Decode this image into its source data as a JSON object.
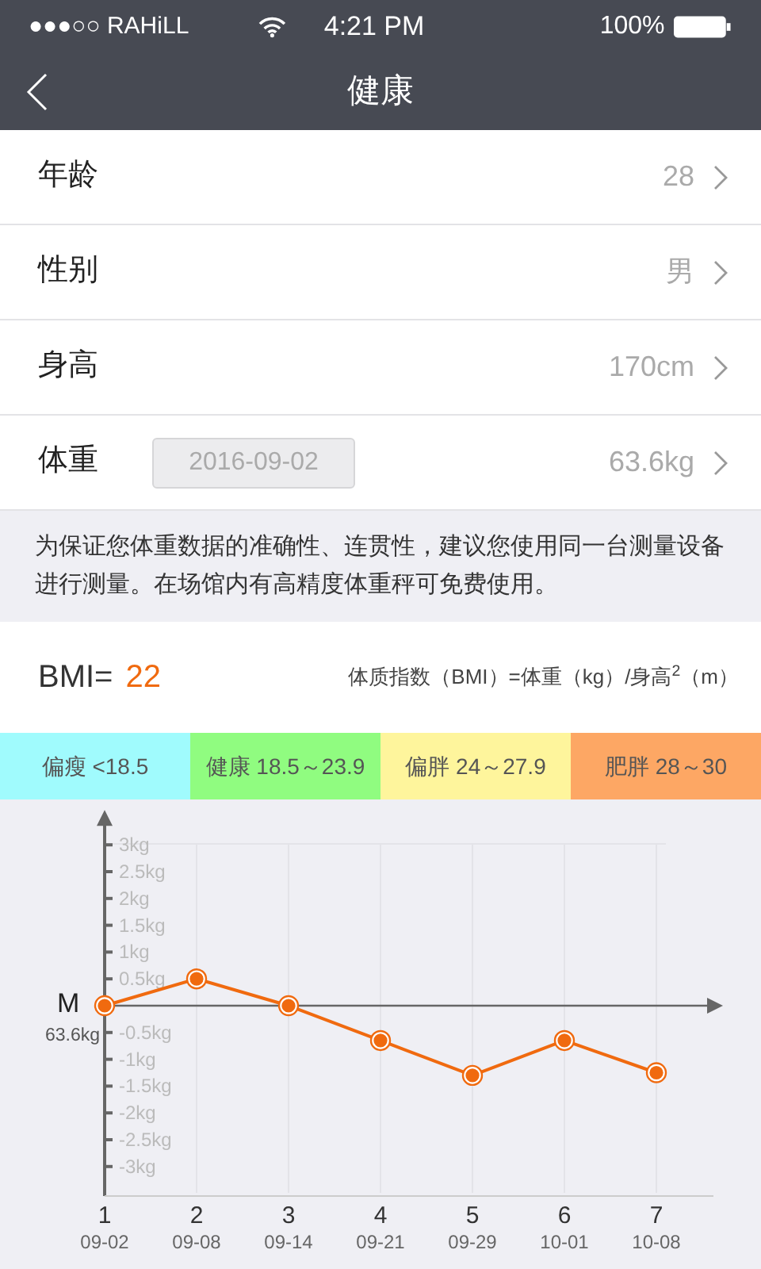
{
  "status_bar": {
    "carrier": "●●●○○ RAHiLL",
    "time": "4:21 PM",
    "battery": "100%"
  },
  "nav": {
    "title": "健康"
  },
  "rows": [
    {
      "label": "年龄",
      "value": "28"
    },
    {
      "label": "性别",
      "value": "男"
    },
    {
      "label": "身高",
      "value": "170cm"
    },
    {
      "label": "体重",
      "date": "2016-09-02",
      "value": "63.6kg"
    }
  ],
  "notice": "为保证您体重数据的准确性、连贯性，建议您使用同一台测量设备进行测量。在场馆内有高精度体重秤可免费使用。",
  "bmi": {
    "label": "BMI=",
    "value": "22",
    "formula": "体质指数（BMI）=体重（kg）/身高$^{2}$（m）"
  },
  "bmi_ranges": [
    {
      "label": "偏瘦 <18.5",
      "color": "#a0fbfd"
    },
    {
      "label": "健康 18.5～23.9",
      "color": "#90fc80"
    },
    {
      "label": "偏胖 24～27.9",
      "color": "#fef59c"
    },
    {
      "label": "肥胖 28～30",
      "color": "#fda764"
    }
  ],
  "weight_chart": {
    "baseline_label": "M",
    "baseline_value": "63.6kg",
    "point_numbers": [
      "1",
      "2",
      "3",
      "4",
      "5",
      "6",
      "7"
    ],
    "chart_data": {
      "type": "line",
      "categories": [
        "09-02",
        "09-08",
        "09-14",
        "09-21",
        "09-29",
        "10-01",
        "10-08"
      ],
      "grid": true,
      "ylim": [
        -3.55,
        3.65
      ],
      "yticks": [
        {
          "value": 3,
          "label": "3kg"
        },
        {
          "value": 2.5,
          "label": "2.5kg"
        },
        {
          "value": 2,
          "label": "2kg"
        },
        {
          "value": 1.5,
          "label": "1.5kg"
        },
        {
          "value": 1,
          "label": "1kg"
        },
        {
          "value": 0.5,
          "label": "0.5kg"
        },
        {
          "value": -0.5,
          "label": "-0.5kg"
        },
        {
          "value": -1,
          "label": "-1kg"
        },
        {
          "value": -1.5,
          "label": "-1.5kg"
        },
        {
          "value": -2,
          "label": "-2kg"
        },
        {
          "value": -2.5,
          "label": "-2.5kg"
        },
        {
          "value": -3,
          "label": "-3kg"
        }
      ],
      "series": [
        {
          "color": "#f06a0f",
          "marker": "circle",
          "values": [
            0,
            0.5,
            0,
            -0.65,
            -1.3,
            -0.65,
            -1.25
          ]
        }
      ]
    }
  }
}
